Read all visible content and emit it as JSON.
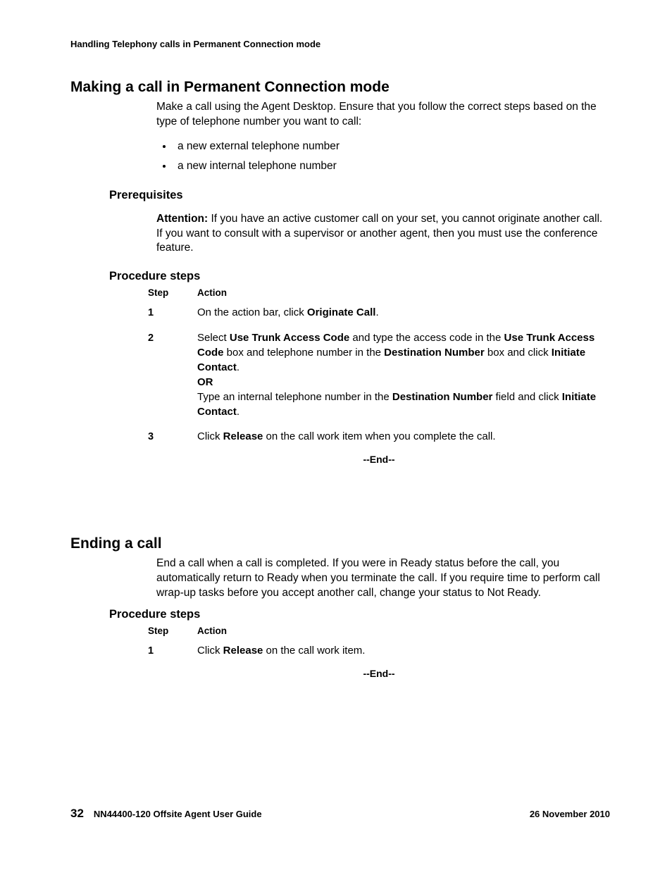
{
  "running_head": "Handling Telephony calls in Permanent Connection mode",
  "section1": {
    "title": "Making a call in Permanent Connection mode",
    "intro": "Make a call using the Agent Desktop. Ensure that you follow the correct steps based on the type of telephone number you want to call:",
    "bullets": [
      "a new external telephone number",
      "a new internal telephone number"
    ],
    "prereq_heading": "Prerequisites",
    "attention_label": "Attention:",
    "attention_text": "If you have an active customer call on your set, you cannot originate another call. If you want to consult with a supervisor or another agent, then you must use the conference feature.",
    "proc_heading": "Procedure steps",
    "step_col": "Step",
    "action_col": "Action",
    "steps": {
      "s1": {
        "num": "1",
        "pre": "On the action bar, click ",
        "b1": "Originate Call",
        "post": "."
      },
      "s2": {
        "num": "2",
        "t1": "Select ",
        "b1": "Use Trunk Access Code",
        "t2": " and type the access code in the ",
        "b2": "Use Trunk Access Code",
        "t3": " box and telephone number in the ",
        "b3": "Destination Number",
        "t4": " box and click ",
        "b4": "Initiate Contact",
        "t5": ".",
        "or": "OR",
        "t6": "Type an internal telephone number in the ",
        "b5": "Destination Number",
        "t7": " field and click ",
        "b6": "Initiate Contact",
        "t8": "."
      },
      "s3": {
        "num": "3",
        "t1": "Click ",
        "b1": "Release",
        "t2": " on the call work item when you complete the call."
      }
    },
    "end": "--End--"
  },
  "section2": {
    "title": "Ending a call",
    "intro": "End a call when a call is completed. If you were in Ready status before the call, you automatically return to Ready when you terminate the call. If you require time to perform call wrap-up tasks before you accept another call, change your status to Not Ready.",
    "proc_heading": "Procedure steps",
    "step_col": "Step",
    "action_col": "Action",
    "steps": {
      "s1": {
        "num": "1",
        "t1": "Click ",
        "b1": "Release",
        "t2": " on the call work item."
      }
    },
    "end": "--End--"
  },
  "footer": {
    "page": "32",
    "doc": "NN44400-120 Offsite Agent User Guide",
    "date": "26 November 2010"
  }
}
